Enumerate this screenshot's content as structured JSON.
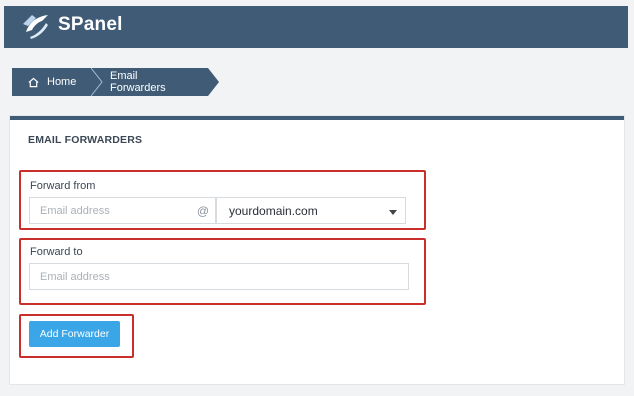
{
  "app": {
    "brand": "SPanel"
  },
  "breadcrumb": {
    "home_label": "Home",
    "current_label": "Email Forwarders"
  },
  "page": {
    "title": "EMAIL FORWARDERS"
  },
  "form": {
    "forward_from_label": "Forward from",
    "forward_from_placeholder": "Email address",
    "at_symbol": "@",
    "domain_selected": "yourdomain.com",
    "forward_to_label": "Forward to",
    "forward_to_placeholder": "Email address",
    "submit_label": "Add Forwarder"
  },
  "colors": {
    "header": "#3f5b75",
    "highlight": "#c9302c",
    "button": "#3aa6e8"
  }
}
